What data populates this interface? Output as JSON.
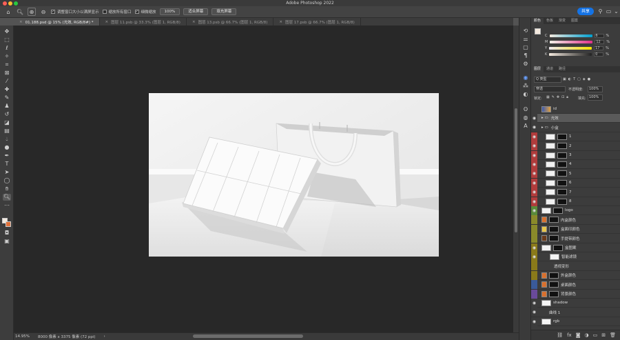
{
  "app": {
    "title": "Adobe Photoshop 2022"
  },
  "options_bar": {
    "resize_windows_label": "调整窗口大小以满屏显示",
    "zoom_all_label": "缩放所有窗口",
    "scrubby_zoom_label": "细微缩放",
    "zoom_value": "100%",
    "fit_screen_label": "适合屏幕",
    "fill_screen_label": "填充屏幕",
    "share_label": "共享"
  },
  "tabs": [
    {
      "label": "01.188.psd @ 15% (光效, RGB/8#) *"
    },
    {
      "label": "图层 11.psb @ 33.3% (图层 1, RGB/8)"
    },
    {
      "label": "图层 13.psb @ 66.7% (图层 1, RGB/8)"
    },
    {
      "label": "图层 17.psb @ 66.7% (图层 1, RGB/8)"
    }
  ],
  "status": {
    "zoom": "14.95%",
    "doc_info": "8000 像素 x 3375 像素 (72 ppi)"
  },
  "color_panel": {
    "tabs": [
      "颜色",
      "色板",
      "渐变",
      "图案"
    ],
    "channels": [
      {
        "label": "C",
        "value": "6",
        "unit": "%"
      },
      {
        "label": "M",
        "value": "12",
        "unit": "%"
      },
      {
        "label": "Y",
        "value": "17",
        "unit": "%"
      },
      {
        "label": "K",
        "value": "0",
        "unit": "%"
      }
    ]
  },
  "layers_panel": {
    "tabs": [
      "图层",
      "通道",
      "路径"
    ],
    "filter_label": "Q 类型",
    "blend_mode": "穿透",
    "opacity_label": "不透明度:",
    "opacity_value": "100%",
    "lock_label": "锁定:",
    "fill_label": "填充:",
    "fill_value": "100%",
    "layers": [
      {
        "name": "id",
        "color": "#3c3c3c",
        "indent": 0,
        "thumb": "photo",
        "eye": ""
      },
      {
        "name": "光效",
        "color": "#3c3c3c",
        "indent": 0,
        "thumb": "folder",
        "eye": "👁"
      },
      {
        "name": "小盒",
        "color": "#3c3c3c",
        "indent": 0,
        "thumb": "folder",
        "eye": "👁"
      },
      {
        "name": "1",
        "color": "#b03c3c",
        "indent": 1,
        "thumb": "smart",
        "eye": "👁"
      },
      {
        "name": "2",
        "color": "#b03c3c",
        "indent": 1,
        "thumb": "smart",
        "eye": "👁"
      },
      {
        "name": "3",
        "color": "#b03c3c",
        "indent": 1,
        "thumb": "smart",
        "eye": "👁"
      },
      {
        "name": "4",
        "color": "#b03c3c",
        "indent": 1,
        "thumb": "smart",
        "eye": "👁"
      },
      {
        "name": "5",
        "color": "#b03c3c",
        "indent": 1,
        "thumb": "smart",
        "eye": "👁"
      },
      {
        "name": "6",
        "color": "#b03c3c",
        "indent": 1,
        "thumb": "smart",
        "eye": "👁"
      },
      {
        "name": "7",
        "color": "#b03c3c",
        "indent": 1,
        "thumb": "smart",
        "eye": "👁"
      },
      {
        "name": "8",
        "color": "#b03c3c",
        "indent": 1,
        "thumb": "smart",
        "eye": "👁"
      },
      {
        "name": "logo",
        "color": "#5a8a3a",
        "indent": 0,
        "thumb": "smart",
        "eye": "👁"
      },
      {
        "name": "内盒颜色",
        "color": "#8a8a2a",
        "indent": 0,
        "thumb": "orange",
        "eye": ""
      },
      {
        "name": "盒面印颜色",
        "color": "#8a8a2a",
        "indent": 0,
        "thumb": "yellow",
        "eye": ""
      },
      {
        "name": "手提带颜色",
        "color": "#8a8a2a",
        "indent": 0,
        "thumb": "brown",
        "eye": ""
      },
      {
        "name": "盒图案",
        "color": "#8a7a1a",
        "indent": 0,
        "thumb": "smart",
        "eye": "👁"
      },
      {
        "name": "智能滤镜",
        "color": "#8a7a1a",
        "indent": 2,
        "thumb": "white",
        "eye": "👁"
      },
      {
        "name": "透视变形",
        "color": "#8a7a1a",
        "indent": 3,
        "thumb": "none",
        "eye": ""
      },
      {
        "name": "外盒颜色",
        "color": "#8a7a1a",
        "indent": 0,
        "thumb": "orange",
        "eye": ""
      },
      {
        "name": "桌面颜色",
        "color": "#3a5a9a",
        "indent": 0,
        "thumb": "orange",
        "eye": ""
      },
      {
        "name": "背景颜色",
        "color": "#6a4a9a",
        "indent": 0,
        "thumb": "orange",
        "eye": ""
      },
      {
        "name": "shadow",
        "color": "#3c3c3c",
        "indent": 0,
        "thumb": "white",
        "eye": "👁"
      },
      {
        "name": "曲线 1",
        "color": "#3c3c3c",
        "indent": 0,
        "thumb": "adjust",
        "eye": "👁"
      },
      {
        "name": "rgb",
        "color": "#3c3c3c",
        "indent": 0,
        "thumb": "white",
        "eye": "👁"
      }
    ]
  }
}
